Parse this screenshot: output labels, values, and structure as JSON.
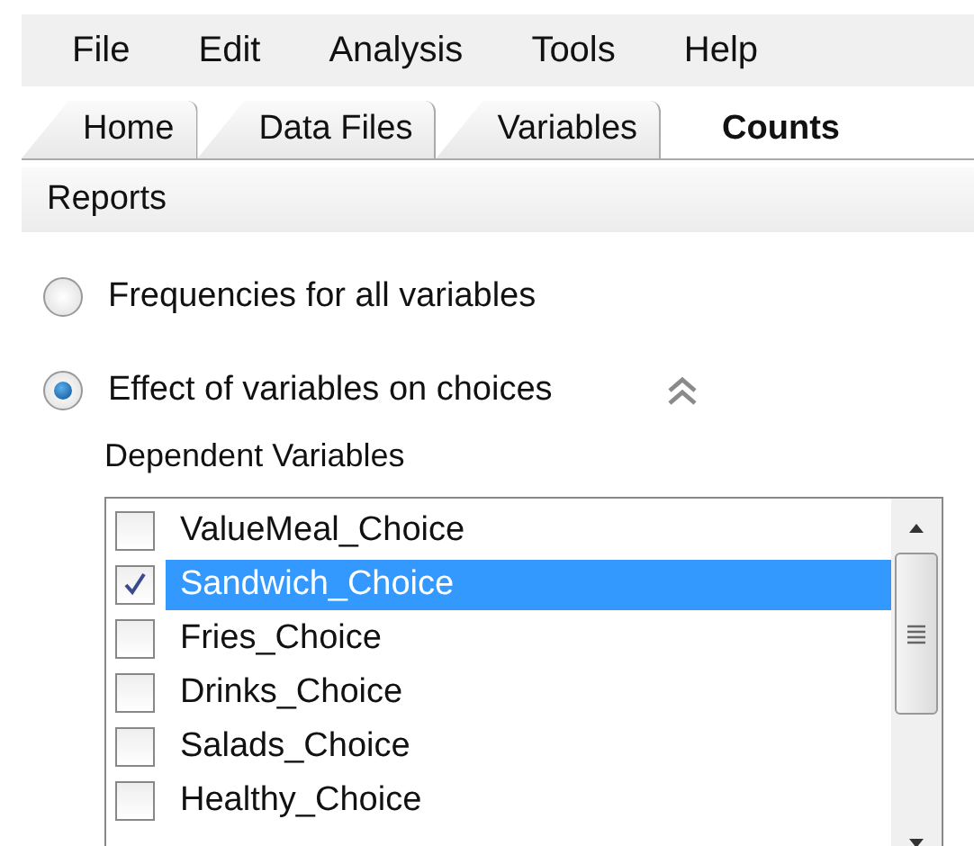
{
  "menu": [
    "File",
    "Edit",
    "Analysis",
    "Tools",
    "Help"
  ],
  "tabs": [
    {
      "label": "Home",
      "selected": false
    },
    {
      "label": "Data Files",
      "selected": false
    },
    {
      "label": "Variables",
      "selected": false
    },
    {
      "label": "Counts",
      "selected": true
    }
  ],
  "section_title": "Reports",
  "options": [
    {
      "label": "Frequencies for all variables",
      "selected": false
    },
    {
      "label": "Effect of variables on choices",
      "selected": true
    }
  ],
  "dependent_variables": {
    "label": "Dependent Variables",
    "items": [
      {
        "label": "ValueMeal_Choice",
        "checked": false,
        "selected": false
      },
      {
        "label": "Sandwich_Choice",
        "checked": true,
        "selected": true
      },
      {
        "label": "Fries_Choice",
        "checked": false,
        "selected": false
      },
      {
        "label": "Drinks_Choice",
        "checked": false,
        "selected": false
      },
      {
        "label": "Salads_Choice",
        "checked": false,
        "selected": false
      },
      {
        "label": "Healthy_Choice",
        "checked": false,
        "selected": false
      }
    ]
  }
}
